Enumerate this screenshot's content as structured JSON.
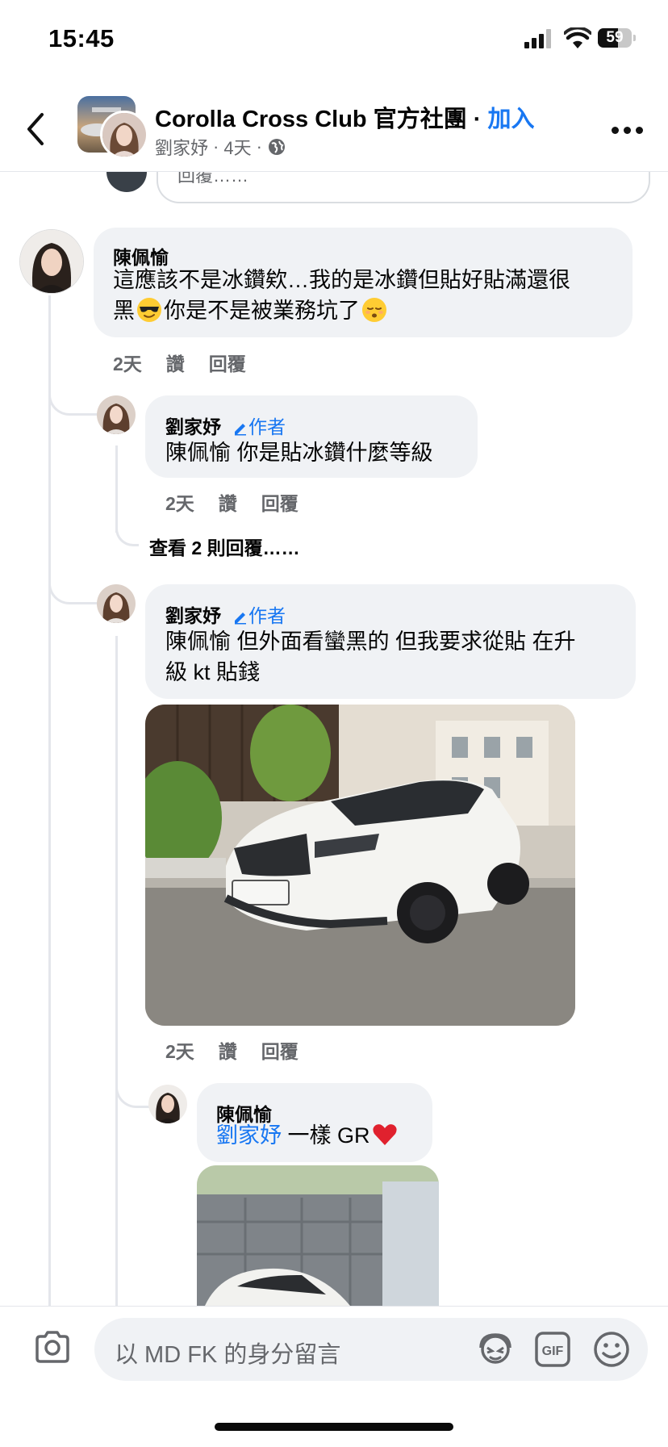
{
  "status_bar": {
    "time": "15:45",
    "battery": "59",
    "battery_level": 0.59
  },
  "header": {
    "group_name": "Corolla Cross Club 官方社團",
    "separator": " · ",
    "join_label": "加入",
    "author": "劉家妤",
    "age": "4天"
  },
  "partial_reply": {
    "placeholder": "回覆……"
  },
  "comments": [
    {
      "name": "陳佩愉",
      "line1": "這應該不是冰鑽欸…我的是冰鑽但貼好貼滿還很",
      "line2_a": "黑",
      "line2_b": "你是不是被業務坑了",
      "time": "2天",
      "like": "讚",
      "reply": "回覆"
    },
    {
      "name": "劉家妤",
      "badge": "作者",
      "text": "陳佩愉 你是貼冰鑽什麼等級",
      "time": "2天",
      "like": "讚",
      "reply": "回覆"
    },
    {
      "name": "劉家妤",
      "badge": "作者",
      "line1": "陳佩愉 但外面看蠻黑的 但我要求從貼 在升",
      "line2": "級 kt 貼錢",
      "time": "2天",
      "like": "讚",
      "reply": "回覆"
    },
    {
      "name": "陳佩愉",
      "mention": "劉家妤",
      "text": " 一樣 GR"
    }
  ],
  "view_replies": "查看 2 則回覆……",
  "composer": {
    "placeholder": "以 MD FK 的身分留言"
  },
  "icons": [
    "back-icon",
    "globe-icon",
    "more-icon",
    "pencil-icon",
    "camera-icon",
    "avatar-sticker-icon",
    "gif-icon",
    "smiley-icon",
    "sunglasses-emoji",
    "relieved-emoji",
    "heart-emoji"
  ],
  "colors": {
    "accent": "#1877f2",
    "bubble": "#f0f2f5",
    "secondary_text": "#65676b"
  }
}
